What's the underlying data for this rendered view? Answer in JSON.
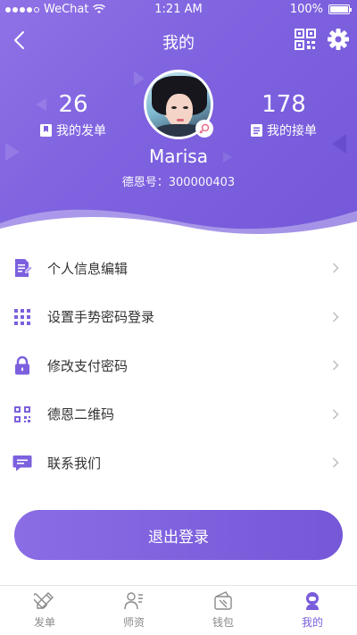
{
  "status_bar": {
    "carrier": "WeChat",
    "time": "1:21 AM",
    "battery": "100%"
  },
  "nav": {
    "title": "我的"
  },
  "profile": {
    "name": "Marisa",
    "uid": "德恩号：300000403",
    "orders_sent_count": "26",
    "orders_sent_label": "我的发单",
    "orders_taken_count": "178",
    "orders_taken_label": "我的接单"
  },
  "menu": {
    "items": [
      {
        "label": "个人信息编辑",
        "icon": "edit-document-icon"
      },
      {
        "label": "设置手势密码登录",
        "icon": "grid-dots-icon"
      },
      {
        "label": "修改支付密码",
        "icon": "lock-icon"
      },
      {
        "label": "德恩二维码",
        "icon": "qr-code-icon"
      },
      {
        "label": "联系我们",
        "icon": "chat-message-icon"
      }
    ]
  },
  "logout_label": "退出登录",
  "tabbar": {
    "items": [
      {
        "label": "发单",
        "icon": "pencil-ruler-icon",
        "active": false
      },
      {
        "label": "师资",
        "icon": "teacher-icon",
        "active": false
      },
      {
        "label": "钱包",
        "icon": "wallet-icon",
        "active": false
      },
      {
        "label": "我的",
        "icon": "user-icon",
        "active": true
      }
    ]
  },
  "colors": {
    "accent": "#7a5ddb",
    "text": "#333333",
    "muted": "#8a8a8a",
    "chevron": "#bbbbbb"
  }
}
